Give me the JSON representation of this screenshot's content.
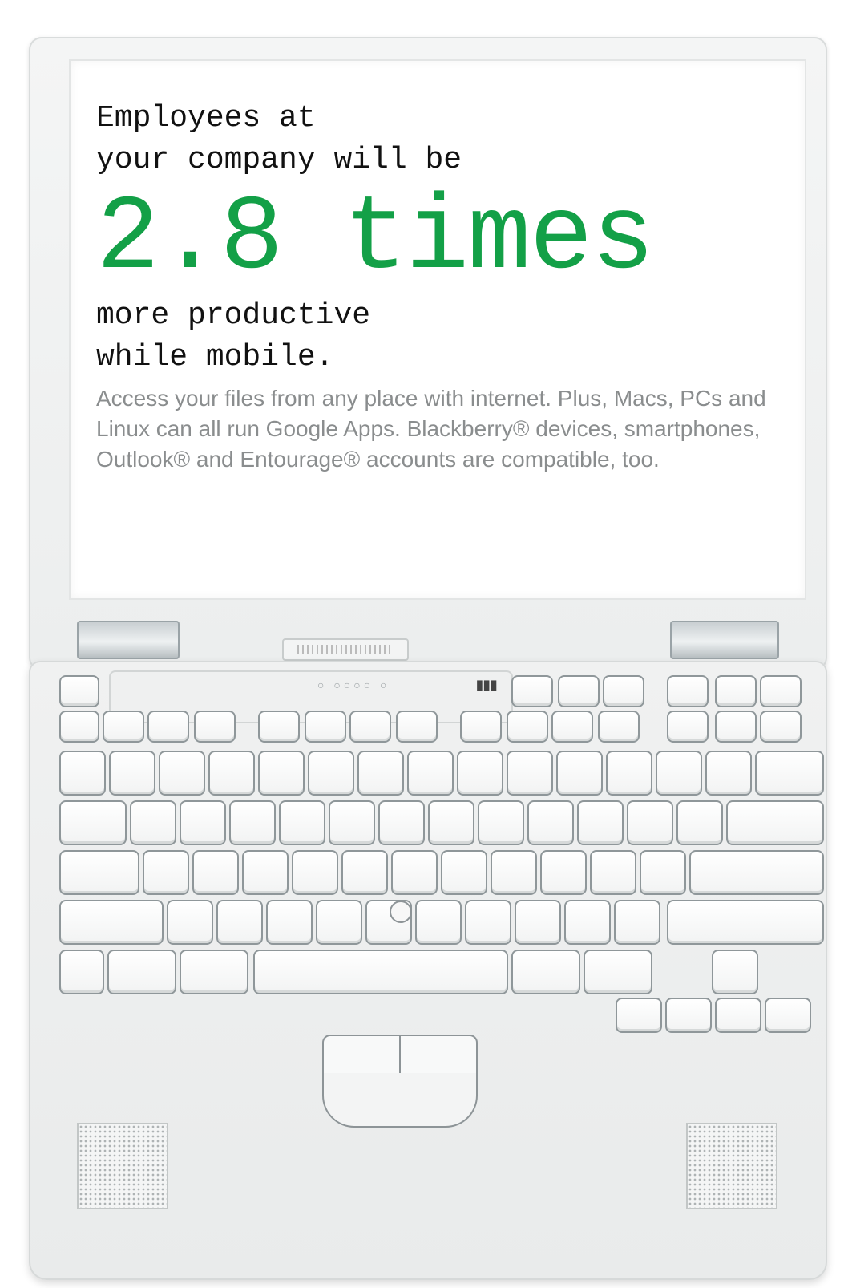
{
  "headline": {
    "intro": "Employees at\nyour company will be",
    "highlight": "2.8 times",
    "outro": "more productive\nwhile mobile."
  },
  "body_copy": "Access your files from any place with internet. Plus, Macs, PCs and Linux can all run Google Apps. Blackberry® devices, smartphones, Outlook® and Entourage® accounts are compatible, too.",
  "colors": {
    "highlight": "#13a047",
    "body_text": "#8a8d8e",
    "headline_text": "#111111"
  },
  "illustration": {
    "subject": "laptop-open-top-view",
    "status_glyphs": "○ ○○○○ ○",
    "indicator_glyphs": "▮▮▮"
  }
}
